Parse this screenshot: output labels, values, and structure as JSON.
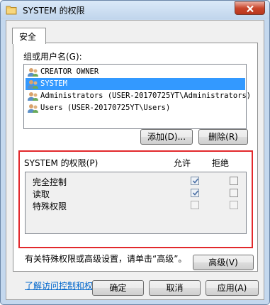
{
  "window": {
    "title": "SYSTEM 的权限"
  },
  "tab": {
    "label": "安全"
  },
  "groups": {
    "label": "组或用户名(G):",
    "users": [
      {
        "name": "CREATOR OWNER",
        "selected": false
      },
      {
        "name": "SYSTEM",
        "selected": true
      },
      {
        "name": "Administrators (USER-20170725YT\\Administrators)",
        "selected": false
      },
      {
        "name": "Users (USER-20170725YT\\Users)",
        "selected": false
      }
    ],
    "add_button": "添加(D)...",
    "remove_button": "删除(R)"
  },
  "permissions": {
    "header": "SYSTEM 的权限(P)",
    "allow_header": "允许",
    "deny_header": "拒绝",
    "rows": [
      {
        "name": "完全控制",
        "allow": true,
        "deny": false,
        "enabled": true
      },
      {
        "name": "读取",
        "allow": true,
        "deny": false,
        "enabled": true
      },
      {
        "name": "特殊权限",
        "allow": false,
        "deny": false,
        "enabled": false
      }
    ],
    "highlight_color": "#e2282b"
  },
  "note": "有关特殊权限或高级设置，请单击“高级”。",
  "advanced_button": "高级(V)",
  "learn_link": "了解访问控制和权限",
  "footer": {
    "ok": "确定",
    "cancel": "取消",
    "apply": "应用(A)"
  },
  "colors": {
    "selection": "#3399ff",
    "link": "#0066cc",
    "close": "#c9462c"
  }
}
